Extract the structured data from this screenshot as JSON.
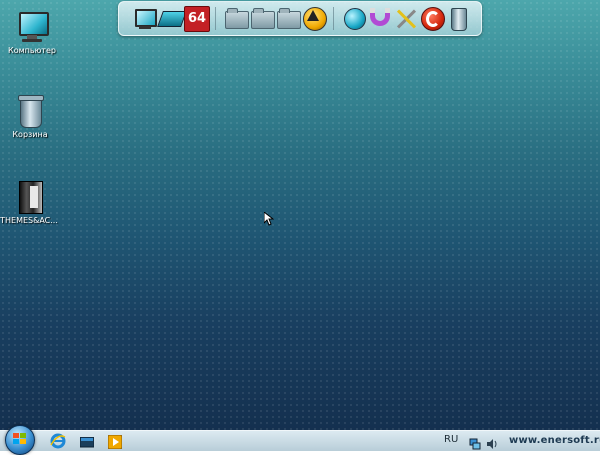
{
  "desktop": {
    "icons": [
      {
        "label": "Компьютер",
        "icon": "computer-icon"
      },
      {
        "label": "Корзина",
        "icon": "recycle-bin-icon"
      },
      {
        "label": "THEMES&AC...",
        "icon": "themes-folder-icon"
      }
    ]
  },
  "dock": {
    "items": [
      {
        "icon": "computer-icon"
      },
      {
        "icon": "network-icon"
      },
      {
        "icon": "aida64-icon",
        "text": "64"
      },
      {
        "icon": "folder-icon"
      },
      {
        "icon": "folder-icon"
      },
      {
        "icon": "folder-icon"
      },
      {
        "icon": "aimp-icon"
      },
      {
        "icon": "globe-icon"
      },
      {
        "icon": "magnet-icon"
      },
      {
        "icon": "tools-icon"
      },
      {
        "icon": "ccleaner-icon"
      },
      {
        "icon": "recycle-bin-icon"
      }
    ]
  },
  "taskbar": {
    "pinned": [
      {
        "icon": "internet-explorer-icon"
      },
      {
        "icon": "show-desktop-icon"
      },
      {
        "icon": "media-player-icon"
      }
    ],
    "language": "RU",
    "tray": [
      {
        "icon": "network-tray-icon"
      },
      {
        "icon": "volume-icon"
      }
    ],
    "watermark": "www.enersoft.ru"
  },
  "colors": {
    "accent": "#3a8fd0",
    "desktop_top": "#4da7ac",
    "desktop_bottom": "#14304f"
  }
}
